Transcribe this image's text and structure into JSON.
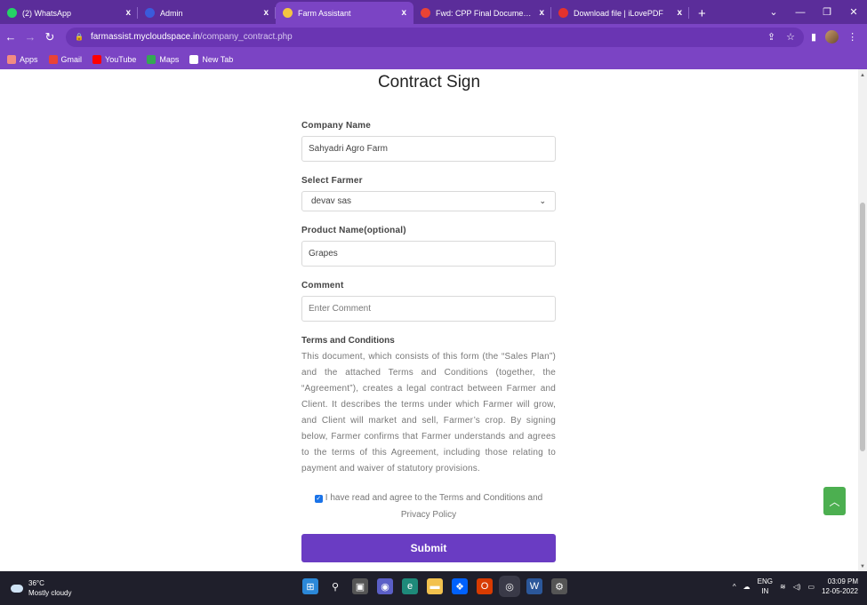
{
  "browser": {
    "tabs": [
      {
        "title": "(2) WhatsApp",
        "icon": "whatsapp-icon",
        "color": "#25d366",
        "active": false
      },
      {
        "title": "Admin",
        "icon": "admin-icon",
        "color": "#3b5bdb",
        "active": false
      },
      {
        "title": "Farm Assistant",
        "icon": "farm-icon",
        "color": "#f4c542",
        "active": true
      },
      {
        "title": "Fwd: CPP Final Documents group",
        "icon": "gmail-icon",
        "color": "#ea4335",
        "active": false
      },
      {
        "title": "Download file | iLovePDF",
        "icon": "ilovepdf-icon",
        "color": "#e5322d",
        "active": false
      }
    ],
    "close_glyph": "x",
    "new_tab": "+",
    "url_host": "farmassist.mycloudspace.in",
    "url_path": "/company_contract.php",
    "bookmarks": [
      {
        "label": "Apps",
        "icon": "apps-grid-icon",
        "color": "#f28b82"
      },
      {
        "label": "Gmail",
        "icon": "gmail-icon",
        "color": "#ea4335"
      },
      {
        "label": "YouTube",
        "icon": "youtube-icon",
        "color": "#ff0000"
      },
      {
        "label": "Maps",
        "icon": "maps-icon",
        "color": "#34a853"
      },
      {
        "label": "New Tab",
        "icon": "new-tab-icon",
        "color": "#ffffff"
      }
    ]
  },
  "page": {
    "title": "Contract Sign",
    "company_label": "Company Name",
    "company_value": "Sahyadri Agro Farm",
    "farmer_label": "Select Farmer",
    "farmer_value": "devav sas",
    "product_label": "Product Name(optional)",
    "product_value": "Grapes",
    "comment_label": "Comment",
    "comment_placeholder": "Enter Comment",
    "terms_title": "Terms and Conditions",
    "terms_body": "This document, which consists of this form (the “Sales Plan”) and the attached Terms and Conditions (together, the “Agreement”), creates a legal contract between Farmer and Client. It describes the terms under which Farmer will grow, and Client will market and sell, Farmer’s crop. By signing below, Farmer confirms that Farmer understands and agrees to the terms of this Agreement, including those relating to payment and waiver of statutory provisions.",
    "agree_text": "I have read and agree to the Terms and Conditions and Privacy Policy",
    "agree_checked": true,
    "submit_label": "Submit",
    "accent": "#6a3cc3",
    "scroll_top_color": "#4caf50"
  },
  "taskbar": {
    "temperature": "36°C",
    "weather": "Mostly cloudy",
    "lang": "ENG",
    "region": "IN",
    "time": "03:09 PM",
    "date": "12-05-2022"
  }
}
